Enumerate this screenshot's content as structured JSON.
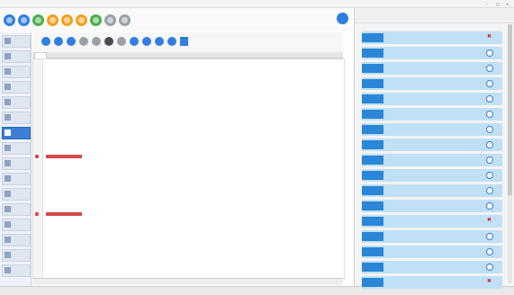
{
  "window": {
    "title": "",
    "controls": [
      "–",
      "□",
      "×"
    ]
  },
  "toolbar1": {
    "buttons": [
      {
        "icon": "connect-icon",
        "color": "#2f7ee0"
      },
      {
        "icon": "sync-icon",
        "color": "#2f7ee0"
      },
      {
        "icon": "run-icon",
        "color": "#4cae4c"
      },
      {
        "icon": "pause-icon",
        "color": "#f0a020"
      },
      {
        "icon": "alarm-icon",
        "color": "#f0a020"
      },
      {
        "icon": "record-icon",
        "color": "#f0a020"
      },
      {
        "icon": "check-icon",
        "color": "#4cae4c"
      },
      {
        "icon": "gear-icon",
        "color": "#9aa0a8"
      },
      {
        "icon": "power-icon",
        "color": "#9aa0a8"
      }
    ],
    "labels": [
      "",
      "",
      ""
    ]
  },
  "left_panel": {
    "items": [
      "",
      "",
      "",
      "",
      "",
      "",
      "",
      "",
      "",
      "",
      "",
      "",
      "",
      "",
      "",
      ""
    ],
    "active_index": 6
  },
  "toolbar2": {
    "icons": [
      "back-icon",
      "forward-icon",
      "record-icon",
      "stop-icon",
      "redo-icon",
      "zoom-icon",
      "cut-icon",
      "copy-icon",
      "paste-icon",
      "refresh-icon",
      "camera-icon",
      "save-icon"
    ]
  },
  "tabs": [
    ""
  ],
  "editor": {
    "lines": [
      "",
      "",
      "",
      "",
      "",
      "",
      "",
      "",
      "",
      "",
      "",
      "",
      "",
      "",
      "",
      "",
      "",
      "",
      "",
      "",
      "",
      "",
      "",
      "",
      "",
      "",
      "",
      "",
      "",
      "",
      "",
      "",
      "",
      "",
      "",
      "",
      "",
      "",
      "",
      ""
    ],
    "highlight_lines": [
      18,
      29
    ],
    "breakpoints": [
      18,
      29
    ]
  },
  "status": {
    "text": ""
  },
  "bottom": {
    "text": ""
  },
  "right_panel": {
    "header_cols": [
      "",
      "",
      "",
      "",
      "",
      "",
      ""
    ],
    "rows": [
      {
        "label": "",
        "text": "",
        "status": "err"
      },
      {
        "label": "",
        "text": "",
        "status": "ok"
      },
      {
        "label": "",
        "text": "",
        "status": "ok"
      },
      {
        "label": "",
        "text": "",
        "status": "ok"
      },
      {
        "label": "",
        "text": "",
        "status": "ok"
      },
      {
        "label": "",
        "text": "",
        "status": "ok"
      },
      {
        "label": "",
        "text": "",
        "status": "ok"
      },
      {
        "label": "",
        "text": "",
        "status": "ok"
      },
      {
        "label": "",
        "text": "",
        "status": "ok"
      },
      {
        "label": "",
        "text": "",
        "status": "ok"
      },
      {
        "label": "",
        "text": "",
        "status": "ok"
      },
      {
        "label": "",
        "text": "",
        "status": "ok"
      },
      {
        "label": "",
        "text": "",
        "status": "err"
      },
      {
        "label": "",
        "text": "",
        "status": "ok"
      },
      {
        "label": "",
        "text": "",
        "status": "ok"
      },
      {
        "label": "",
        "text": "",
        "status": "ok"
      },
      {
        "label": "",
        "text": "",
        "status": "err"
      }
    ]
  }
}
